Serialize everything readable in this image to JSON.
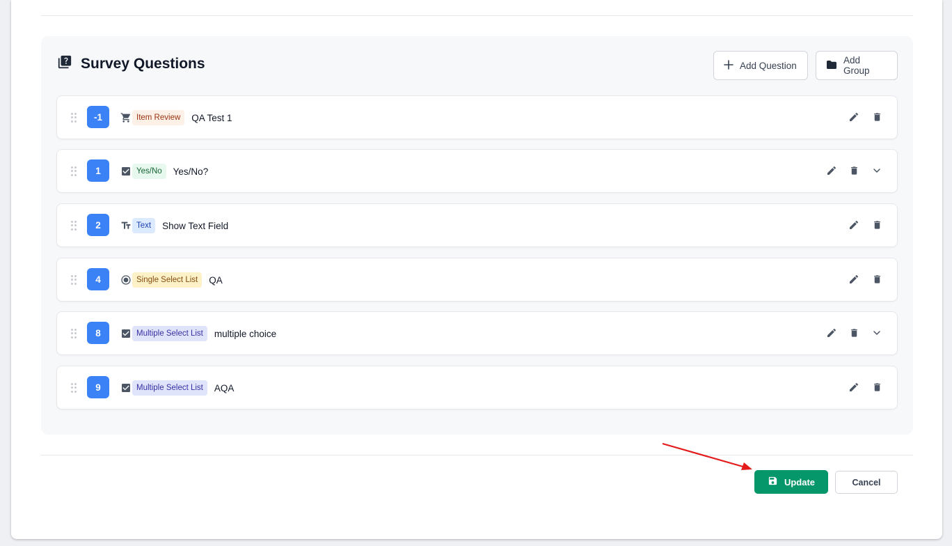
{
  "panel": {
    "title": "Survey Questions",
    "add_question_label": "Add Question",
    "add_group_label": "Add Group"
  },
  "questions": [
    {
      "number": "-1",
      "type_label": "Item Review",
      "type_icon": "cart-icon",
      "text": "QA Test 1",
      "expandable": false
    },
    {
      "number": "1",
      "type_label": "Yes/No",
      "type_icon": "checkbox-icon",
      "text": "Yes/No?",
      "expandable": true
    },
    {
      "number": "2",
      "type_label": "Text",
      "type_icon": "text-format-icon",
      "text": "Show Text Field",
      "expandable": false
    },
    {
      "number": "4",
      "type_label": "Single Select List",
      "type_icon": "radio-icon",
      "text": "QA",
      "expandable": false
    },
    {
      "number": "8",
      "type_label": "Multiple Select List",
      "type_icon": "checkbox-icon",
      "text": "multiple choice",
      "expandable": true
    },
    {
      "number": "9",
      "type_label": "Multiple Select List",
      "type_icon": "checkbox-icon",
      "text": "AQA",
      "expandable": false
    }
  ],
  "footer": {
    "update_label": "Update",
    "cancel_label": "Cancel"
  },
  "colors": {
    "accent_blue": "#3b82f6",
    "update_green": "#059669",
    "annotation_red": "#e31b1b"
  }
}
